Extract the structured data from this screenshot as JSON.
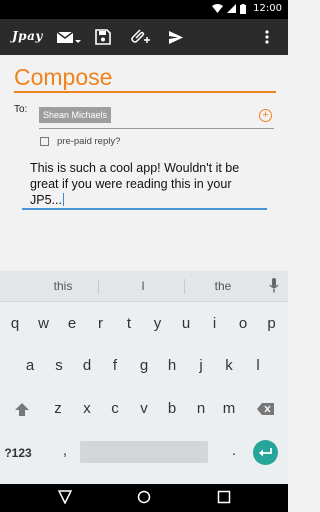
{
  "status_bar": {
    "time": "12:00"
  },
  "action_bar": {
    "logo": "Jpay",
    "icons": [
      "mail-dropdown-icon",
      "save-icon",
      "attach-icon",
      "send-icon",
      "overflow-menu-icon"
    ]
  },
  "compose": {
    "title": "Compose",
    "to_label": "To:",
    "recipient": "Shean Michaels",
    "prepaid_label": "pre-paid reply?",
    "message": "This is such a cool app! Wouldn't it be great if you were reading this in your JP5..."
  },
  "keyboard": {
    "suggestions": [
      "this",
      "I",
      "the"
    ],
    "row1": [
      "q",
      "w",
      "e",
      "r",
      "t",
      "y",
      "u",
      "i",
      "o",
      "p"
    ],
    "row2": [
      "a",
      "s",
      "d",
      "f",
      "g",
      "h",
      "j",
      "k",
      "l"
    ],
    "row3": [
      "z",
      "x",
      "c",
      "v",
      "b",
      "n",
      "m"
    ],
    "symbols_key": "?123",
    "comma": ",",
    "period": "."
  },
  "colors": {
    "accent": "#f0821e",
    "focus": "#4a93d6",
    "enter": "#26a69a"
  }
}
